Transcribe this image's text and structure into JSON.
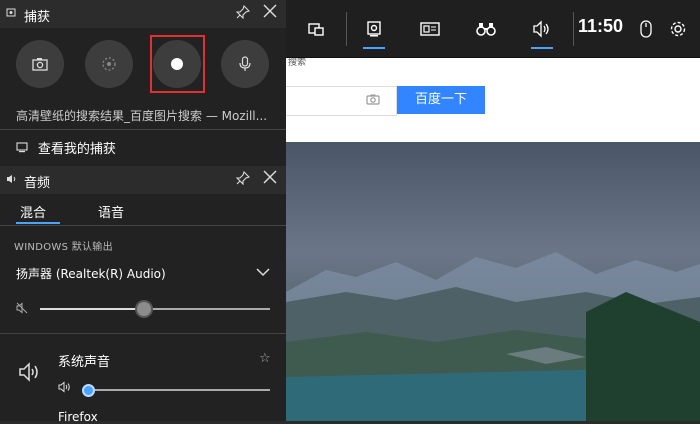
{
  "browser": {
    "top_text": "搜索",
    "search_button": "百度一下",
    "camera_icon": "camera-icon"
  },
  "gamebar": {
    "time": "11:50",
    "icons": [
      "widget-icon",
      "capture-widget-icon",
      "performance-icon",
      "binoculars-icon",
      "audio-icon",
      "mouse-icon",
      "settings-icon"
    ]
  },
  "capture": {
    "title": "捕获",
    "target": "高清壁纸的搜索结果_百度图片搜索 — Mozill...",
    "view_link": "查看我的捕获",
    "recording_highlight": "#e03030"
  },
  "audio": {
    "title": "音频",
    "tabs": [
      "混合",
      "语音"
    ],
    "active_tab": "混合",
    "section_label": "WINDOWS 默认输出",
    "device": "扬声器 (Realtek(R) Audio)",
    "master_level": 0.45,
    "system_sound_label": "系统声音",
    "system_level": 0.0,
    "next_app": "Firefox"
  },
  "colors": {
    "accent": "#4aa3ff",
    "panel": "#222222",
    "baidu_blue": "#3385ff"
  }
}
